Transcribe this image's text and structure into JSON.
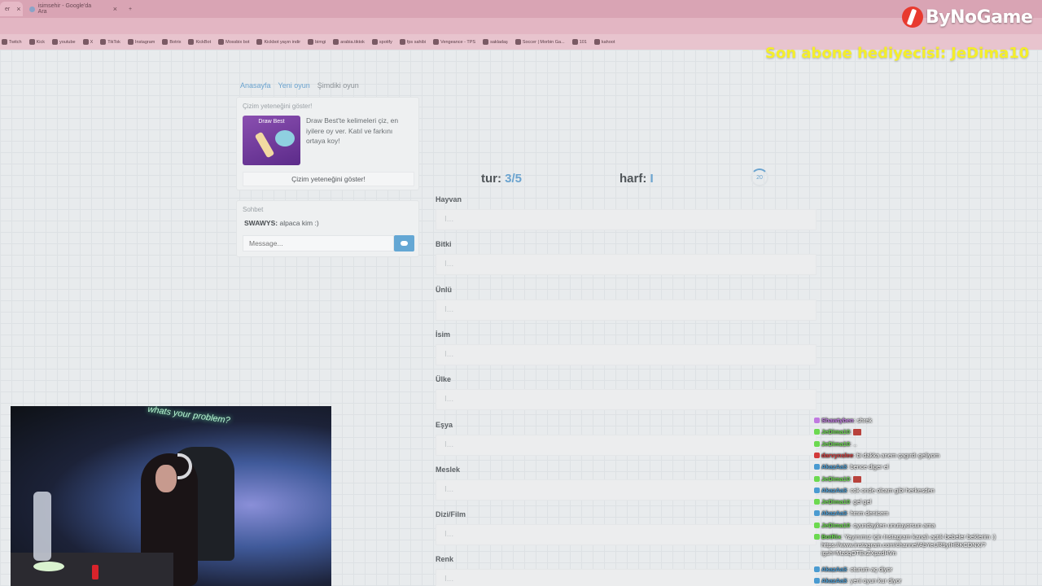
{
  "browser": {
    "tabs": [
      {
        "label": "er"
      },
      {
        "label": "isimsehir - Google'da Ara"
      }
    ],
    "new_tab": "+",
    "bookmarks": [
      "Twitch",
      "Kick",
      "youtube",
      "X",
      "TikTok",
      "Instagram",
      "Botrix",
      "KickBot",
      "Mossbix bot",
      "Kickbot yayın indir",
      "bimgi",
      "arabia.tiktok",
      "spotify",
      "fps sahibi",
      "Vengeance - TPS",
      "sakladaş",
      "Soccer | Morbin Ga...",
      "101",
      "kahoot"
    ]
  },
  "overlay": {
    "brand": "ByNoGame",
    "sub_gift": "Son abone hediyecisi: JeDima10"
  },
  "nav": {
    "home": "Anasayfa",
    "new_game": "Yeni oyun",
    "current": "Şimdiki oyun"
  },
  "promo": {
    "title": "Çizim yeteneğini göster!",
    "image_label": "Draw Best",
    "text": "Draw Best'te kelimeleri çiz, en iyilere oy ver. Katıl ve farkını ortaya koy!",
    "button": "Çizim yeteneğini göster!"
  },
  "chat": {
    "title": "Sohbet",
    "user": "SWAWYS:",
    "message": "alpaca kim :)",
    "input_placeholder": "Message..."
  },
  "game": {
    "round_label": "tur:",
    "round_value": "3/5",
    "letter_label": "harf:",
    "letter_value": "I",
    "timer": "20",
    "categories": [
      {
        "label": "Hayvan",
        "value": "I..."
      },
      {
        "label": "Bitki",
        "value": "I..."
      },
      {
        "label": "Ünlü",
        "value": "I..."
      },
      {
        "label": "İsim",
        "value": "I..."
      },
      {
        "label": "Ülke",
        "value": "I..."
      },
      {
        "label": "Eşya",
        "value": "I..."
      },
      {
        "label": "Meslek",
        "value": "I..."
      },
      {
        "label": "Dizi/Film",
        "value": "I..."
      },
      {
        "label": "Renk",
        "value": "I..."
      }
    ]
  },
  "webcam": {
    "neon_text": "whats your problem?"
  },
  "stream_chat": [
    {
      "user": "Shawtyben",
      "text": ": shrek",
      "color": "#c07ae0"
    },
    {
      "user": "JeDima10",
      "text": ":",
      "color": "#6bd94f",
      "emote": true
    },
    {
      "user": "JeDima10",
      "text": ": ..",
      "color": "#6bd94f"
    },
    {
      "user": "darvynslee",
      "text": ": bi dakka anem çagırdı geliyom",
      "color": "#d23a3a"
    },
    {
      "user": "AkazAa3",
      "text": ": bence diger el",
      "color": "#4a9bd1"
    },
    {
      "user": "JeDima10",
      "text": ":",
      "color": "#6bd94f",
      "emote": true
    },
    {
      "user": "AkazAa3",
      "text": ": cok onde olcam gibi herkesden",
      "color": "#4a9bd1"
    },
    {
      "user": "JeDima10",
      "text": ": gel gel",
      "color": "#6bd94f"
    },
    {
      "user": "AkazAa3",
      "text": ": hmm denicem",
      "color": "#4a9bd1"
    },
    {
      "user": "JeDima10",
      "text": ": oyundayken unutuyorsun ama",
      "color": "#6bd94f"
    },
    {
      "user": "BotRix",
      "text": ": Yayınımız için Instagram kanalı açtık bebeler beklerim :) https://www.instagram.com/channel/AbYeUR9yIHRKCDNX/?igsh=MzdqOTExZXpzdHVn",
      "color": "#6bd94f",
      "wrap": true
    },
    {
      "user": "AkazAa3",
      "text": ": oturum aç diyor",
      "color": "#4a9bd1"
    },
    {
      "user": "AkazAa3",
      "text": ": yeni oyun kur diyor",
      "color": "#4a9bd1"
    }
  ]
}
